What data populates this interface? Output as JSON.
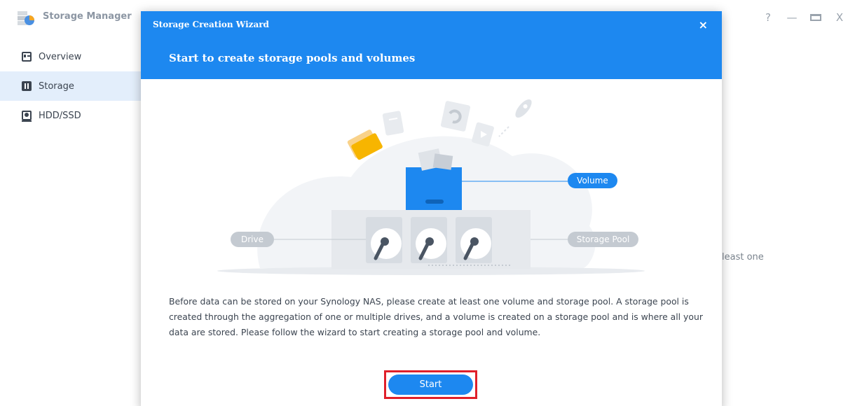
{
  "window": {
    "title": "Storage Manager",
    "controls": [
      "?",
      "—",
      "X"
    ]
  },
  "sidebar": {
    "items": [
      {
        "label": "Overview",
        "icon": "overview-icon",
        "active": false
      },
      {
        "label": "Storage",
        "icon": "storage-icon",
        "active": true
      },
      {
        "label": "HDD/SSD",
        "icon": "hdd-icon",
        "active": false
      }
    ]
  },
  "background": {
    "partial_text": "least one"
  },
  "wizard": {
    "window_title": "Storage Creation Wizard",
    "close_label": "×",
    "heading": "Start to create storage pools and volumes",
    "illustration": {
      "volume_label": "Volume",
      "drive_label": "Drive",
      "storage_pool_label": "Storage Pool"
    },
    "description": "Before data can be stored on your Synology NAS, please create at least one volume and storage pool. A storage pool is created through the aggregation of one or multiple drives, and a volume is created on a storage pool and is where all your data are stored. Please follow the wizard to start creating a storage pool and volume.",
    "start_label": "Start"
  },
  "colors": {
    "accent": "#1d88f0",
    "highlight_border": "#e0202a",
    "sidebar_active": "#e3eefb",
    "folder_yellow": "#f7b500"
  }
}
